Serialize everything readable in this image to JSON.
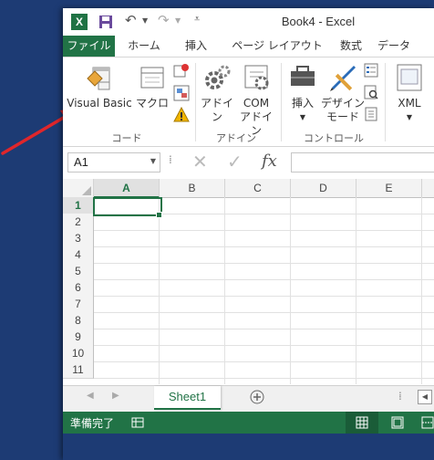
{
  "window": {
    "title": "Book4 - Excel"
  },
  "qat": {
    "save_icon": "save-icon",
    "undo_icon": "undo-icon",
    "redo_icon": "redo-icon",
    "customize_icon": "customize-icon"
  },
  "tabs": [
    {
      "label": "ファイル",
      "active": true
    },
    {
      "label": "ホーム"
    },
    {
      "label": "挿入"
    },
    {
      "label": "ページ レイアウト"
    },
    {
      "label": "数式"
    },
    {
      "label": "データ"
    }
  ],
  "ribbon": {
    "visual_basic": "Visual Basic",
    "macro": "マクロ",
    "addin": "アドイン",
    "com_addin_1": "COM",
    "com_addin_2": "アドイン",
    "insert": "挿入",
    "design_mode_1": "デザイン",
    "design_mode_2": "モード",
    "xml": "XML",
    "group_code": "コード",
    "group_addin": "アドイン",
    "group_control": "コントロール"
  },
  "formula_bar": {
    "name_box": "A1",
    "fx_label": "fx",
    "cancel_icon": "cancel-icon",
    "enter_icon": "enter-icon"
  },
  "columns": [
    "A",
    "B",
    "C",
    "D",
    "E"
  ],
  "rows": [
    "1",
    "2",
    "3",
    "4",
    "5",
    "6",
    "7",
    "8",
    "9",
    "10",
    "11"
  ],
  "sheet_tab": "Sheet1",
  "status": {
    "ready": "準備完了"
  },
  "colors": {
    "excel_green": "#217346",
    "desktop": "#1d3b74"
  }
}
